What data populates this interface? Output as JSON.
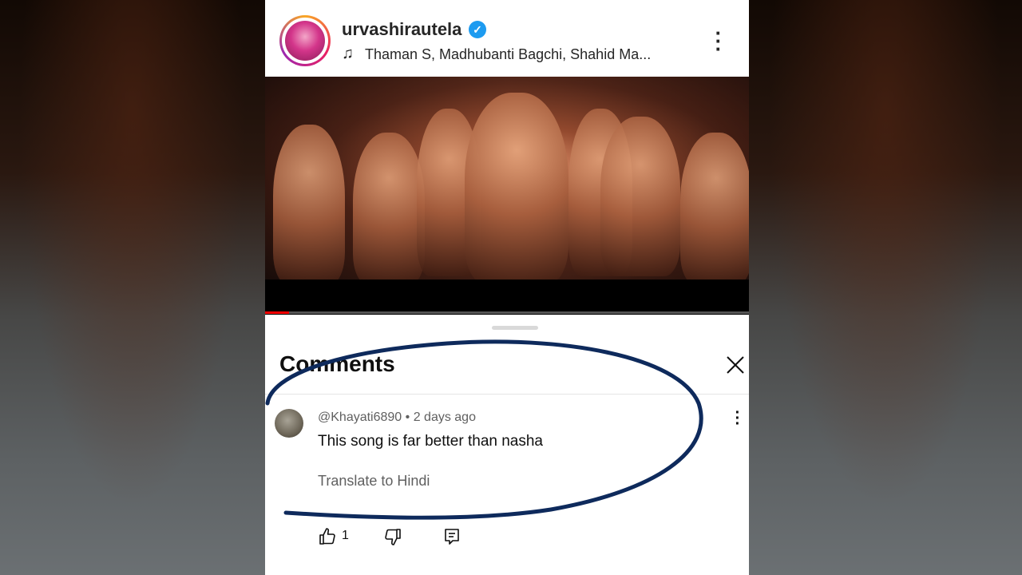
{
  "post": {
    "username": "urvashirautela",
    "verified_icon": "verified-badge-icon",
    "music_icon": "music-note-icon",
    "audio_credit": "Thaman S, Madhubanti Bagchi, Shahid Ma..."
  },
  "video": {
    "progress_fraction": 0.05,
    "progress_color": "#ff0000"
  },
  "comments": {
    "title": "Comments",
    "items": [
      {
        "author": "@Khayati6890",
        "time": "2 days ago",
        "meta": "@Khayati6890 • 2 days ago",
        "text": "This song is far better than nasha",
        "translate_label": "Translate to Hindi",
        "likes": "1"
      }
    ]
  },
  "colors": {
    "annotation": "#0e2a5c",
    "verified": "#1d9bf0"
  }
}
